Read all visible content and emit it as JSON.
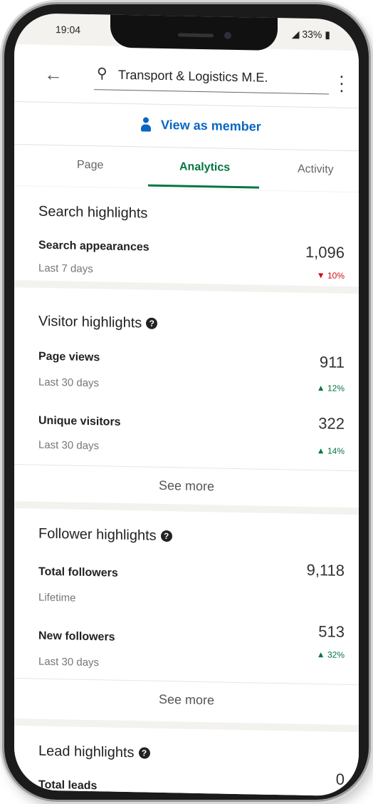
{
  "status_bar": {
    "time": "19:04",
    "battery": "33%"
  },
  "header": {
    "search_query": "Transport & Logistics M.E."
  },
  "view_as_member": "View as member",
  "tabs": [
    {
      "label": "Page",
      "active": false
    },
    {
      "label": "Analytics",
      "active": true
    },
    {
      "label": "Activity",
      "active": false
    }
  ],
  "search_highlights": {
    "title": "Search highlights",
    "metrics": [
      {
        "label": "Search appearances",
        "period": "Last 7 days",
        "value": "1,096",
        "change": "10%",
        "direction": "down"
      }
    ]
  },
  "visitor_highlights": {
    "title": "Visitor highlights",
    "metrics": [
      {
        "label": "Page views",
        "period": "Last 30 days",
        "value": "911",
        "change": "12%",
        "direction": "up"
      },
      {
        "label": "Unique visitors",
        "period": "Last 30 days",
        "value": "322",
        "change": "14%",
        "direction": "up"
      }
    ],
    "see_more": "See more"
  },
  "follower_highlights": {
    "title": "Follower highlights",
    "metrics": [
      {
        "label": "Total followers",
        "period": "Lifetime",
        "value": "9,118"
      },
      {
        "label": "New followers",
        "period": "Last 30 days",
        "value": "513",
        "change": "32%",
        "direction": "up"
      }
    ],
    "see_more": "See more"
  },
  "lead_highlights": {
    "title": "Lead highlights",
    "metrics": [
      {
        "label": "Total leads",
        "value": "0"
      }
    ]
  },
  "colors": {
    "accent": "#0a66c2",
    "positive": "#057642",
    "negative": "#cc1016"
  }
}
